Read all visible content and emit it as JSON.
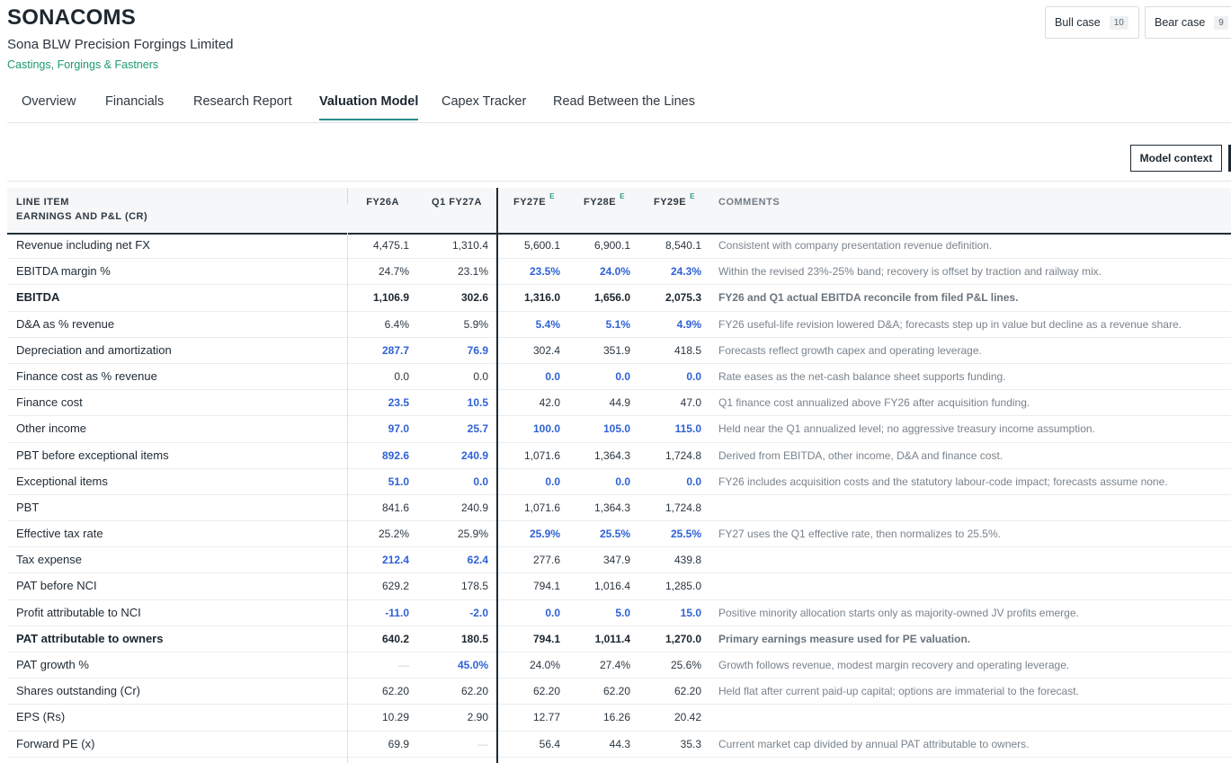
{
  "header": {
    "ticker": "SONACOMS",
    "company": "Sona BLW Precision Forgings Limited",
    "sector": "Castings, Forgings & Fastners",
    "bull_case": {
      "label": "Bull case",
      "count": "10"
    },
    "bear_case": {
      "label": "Bear case",
      "count": "9"
    }
  },
  "tabs": [
    "Overview",
    "Financials",
    "Research Report",
    "Valuation Model",
    "Capex Tracker",
    "Read Between the Lines"
  ],
  "active_tab": "Valuation Model",
  "toolbar": {
    "model_context": "Model context"
  },
  "table": {
    "headers": {
      "line_item": "LINE ITEM",
      "fy26a": "FY26A",
      "q1fy27a": "Q1 FY27A",
      "fy27e": "FY27E",
      "fy28e": "FY28E",
      "fy29e": "FY29E",
      "est_marker": "E",
      "comments": "COMMENTS"
    },
    "section": "EARNINGS AND P&L (CR)",
    "rows": [
      {
        "label": "Revenue including net FX",
        "v": [
          "4,475.1",
          "1,310.4",
          "5,600.1",
          "6,900.1",
          "8,540.1"
        ],
        "comment": "Consistent with company presentation revenue definition."
      },
      {
        "label": "EBITDA margin %",
        "v": [
          "24.7%",
          "23.1%",
          "23.5%",
          "24.0%",
          "24.3%"
        ],
        "comment": "Within the revised 23%-25% band; recovery is offset by traction and railway mix."
      },
      {
        "label": "EBITDA",
        "v": [
          "1,106.9",
          "302.6",
          "1,316.0",
          "1,656.0",
          "2,075.3"
        ],
        "comment": "FY26 and Q1 actual EBITDA reconcile from filed P&L lines."
      },
      {
        "label": "D&A as % revenue",
        "v": [
          "6.4%",
          "5.9%",
          "5.4%",
          "5.1%",
          "4.9%"
        ],
        "comment": "FY26 useful-life revision lowered D&A; forecasts step up in value but decline as a revenue share."
      },
      {
        "label": "Depreciation and amortization",
        "v": [
          "287.7",
          "76.9",
          "302.4",
          "351.9",
          "418.5"
        ],
        "comment": "Forecasts reflect growth capex and operating leverage."
      },
      {
        "label": "Finance cost as % revenue",
        "v": [
          "0.0",
          "0.0",
          "0.0",
          "0.0",
          "0.0"
        ],
        "comment": "Rate eases as the net-cash balance sheet supports funding."
      },
      {
        "label": "Finance cost",
        "v": [
          "23.5",
          "10.5",
          "42.0",
          "44.9",
          "47.0"
        ],
        "comment": "Q1 finance cost annualized above FY26 after acquisition funding."
      },
      {
        "label": "Other income",
        "v": [
          "97.0",
          "25.7",
          "100.0",
          "105.0",
          "115.0"
        ],
        "comment": "Held near the Q1 annualized level; no aggressive treasury income assumption."
      },
      {
        "label": "PBT before exceptional items",
        "v": [
          "892.6",
          "240.9",
          "1,071.6",
          "1,364.3",
          "1,724.8"
        ],
        "comment": "Derived from EBITDA, other income, D&A and finance cost."
      },
      {
        "label": "Exceptional items",
        "v": [
          "51.0",
          "0.0",
          "0.0",
          "0.0",
          "0.0"
        ],
        "comment": "FY26 includes acquisition costs and the statutory labour-code impact; forecasts assume none."
      },
      {
        "label": "PBT",
        "v": [
          "841.6",
          "240.9",
          "1,071.6",
          "1,364.3",
          "1,724.8"
        ],
        "comment": ""
      },
      {
        "label": "Effective tax rate",
        "v": [
          "25.2%",
          "25.9%",
          "25.9%",
          "25.5%",
          "25.5%"
        ],
        "comment": "FY27 uses the Q1 effective rate, then normalizes to 25.5%."
      },
      {
        "label": "Tax expense",
        "v": [
          "212.4",
          "62.4",
          "277.6",
          "347.9",
          "439.8"
        ],
        "comment": ""
      },
      {
        "label": "PAT before NCI",
        "v": [
          "629.2",
          "178.5",
          "794.1",
          "1,016.4",
          "1,285.0"
        ],
        "comment": ""
      },
      {
        "label": "Profit attributable to NCI",
        "v": [
          "-11.0",
          "-2.0",
          "0.0",
          "5.0",
          "15.0"
        ],
        "comment": "Positive minority allocation starts only as majority-owned JV profits emerge."
      },
      {
        "label": "PAT attributable to owners",
        "v": [
          "640.2",
          "180.5",
          "794.1",
          "1,011.4",
          "1,270.0"
        ],
        "comment": "Primary earnings measure used for PE valuation."
      },
      {
        "label": "PAT growth %",
        "v": [
          "—",
          "45.0%",
          "24.0%",
          "27.4%",
          "25.6%"
        ],
        "comment": "Growth follows revenue, modest margin recovery and operating leverage."
      },
      {
        "label": "Shares outstanding (Cr)",
        "v": [
          "62.20",
          "62.20",
          "62.20",
          "62.20",
          "62.20"
        ],
        "comment": "Held flat after current paid-up capital; options are immaterial to the forecast."
      },
      {
        "label": "EPS (Rs)",
        "v": [
          "10.29",
          "2.90",
          "12.77",
          "16.26",
          "20.42"
        ],
        "comment": ""
      },
      {
        "label": "Forward PE (x)",
        "v": [
          "69.9",
          "—",
          "56.4",
          "44.3",
          "35.3"
        ],
        "comment": "Current market cap divided by annual PAT attributable to owners."
      }
    ]
  },
  "colors": {
    "input_blue": "#2f62d6",
    "accent_green": "#1f9a6e",
    "tab_underline": "#2a8f8a"
  }
}
